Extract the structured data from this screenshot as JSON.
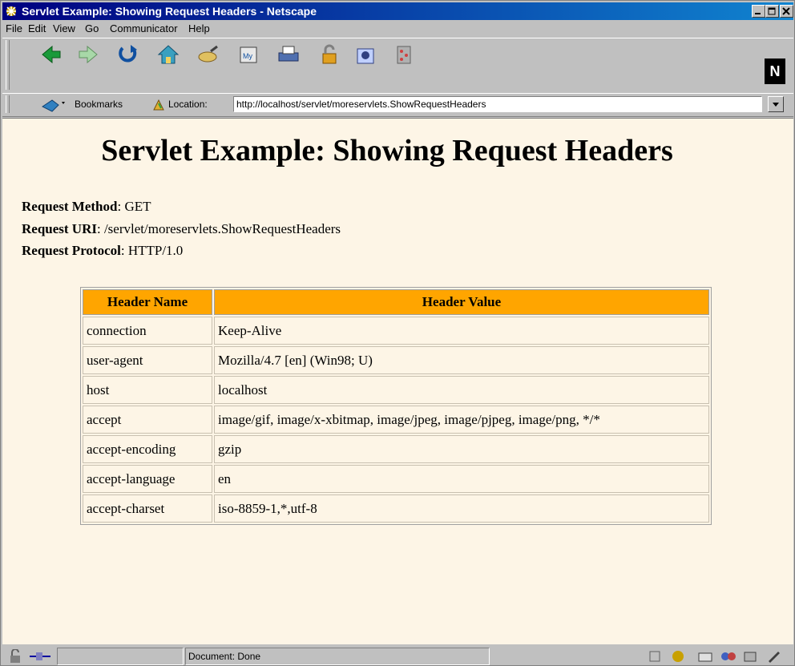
{
  "window": {
    "title": "Servlet Example: Showing Request Headers - Netscape"
  },
  "menu": [
    "File",
    "Edit",
    "View",
    "Go",
    "Communicator",
    "Help"
  ],
  "toolbar": {
    "icons": [
      "back-icon",
      "forward-icon",
      "reload-icon",
      "home-icon",
      "search-icon",
      "mynetscape-icon",
      "print-icon",
      "security-icon",
      "shop-icon",
      "stop-icon"
    ],
    "netscape_logo": "N"
  },
  "location_bar": {
    "bookmarks_label": "Bookmarks",
    "location_label": "Location:",
    "url": "http://localhost/servlet/moreservlets.ShowRequestHeaders"
  },
  "page": {
    "heading": "Servlet Example: Showing Request Headers",
    "request_method_label": "Request Method",
    "request_method_value": ": GET",
    "request_uri_label": "Request URI",
    "request_uri_value": ": /servlet/moreservlets.ShowRequestHeaders",
    "request_protocol_label": "Request Protocol",
    "request_protocol_value": ": HTTP/1.0",
    "table": {
      "header_bg": "#ffa500",
      "columns": [
        "Header Name",
        "Header Value"
      ],
      "rows": [
        [
          "connection",
          "Keep-Alive"
        ],
        [
          "user-agent",
          "Mozilla/4.7 [en] (Win98; U)"
        ],
        [
          "host",
          "localhost"
        ],
        [
          "accept",
          "image/gif, image/x-xbitmap, image/jpeg, image/pjpeg, image/png, */*"
        ],
        [
          "accept-encoding",
          "gzip"
        ],
        [
          "accept-language",
          "en"
        ],
        [
          "accept-charset",
          "iso-8859-1,*,utf-8"
        ]
      ]
    }
  },
  "status": {
    "text": "Document: Done"
  },
  "colors": {
    "titlebar": "#000080",
    "page_background": "#fdf5e6",
    "chrome": "#c0c0c0"
  }
}
